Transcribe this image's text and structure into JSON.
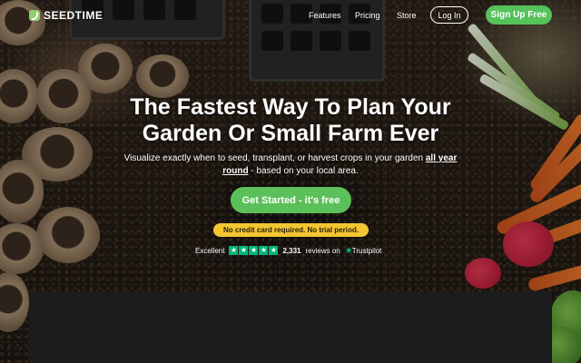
{
  "brand": {
    "name": "SEEDTIME"
  },
  "nav": {
    "links": [
      "Features",
      "Pricing",
      "Store"
    ],
    "login_label": "Log In",
    "signup_label": "Sign Up Free"
  },
  "hero": {
    "headline_line1": "The Fastest Way To Plan Your",
    "headline_line2": "Garden Or Small Farm Ever",
    "sub_text": "Visualize exactly when to seed, transplant, or harvest crops in your garden",
    "sub_emphasis": "all year round",
    "sub_tail": "- based on your local area.",
    "cta_label": "Get Started - it's free",
    "notice": "No credit card required.  No trial period."
  },
  "trust": {
    "rating_word": "Excellent",
    "stars": 5,
    "reviews_count": "2,331",
    "reviews_text": "reviews on",
    "provider": "Trustpilot"
  },
  "colors": {
    "accent_green": "#5cc05a",
    "notice_yellow": "#f3c632",
    "trustpilot_green": "#00b67a"
  }
}
